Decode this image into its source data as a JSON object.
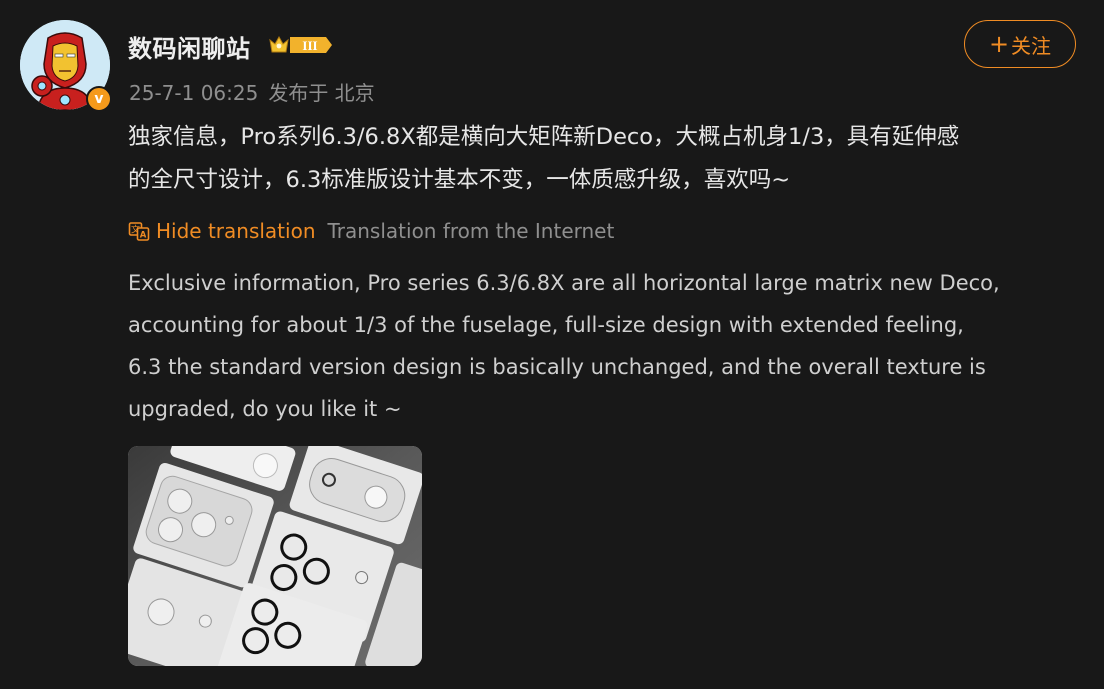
{
  "author": {
    "name": "数码闲聊站",
    "level_badge": "III",
    "verified_mark": "v",
    "avatar_icon": "iron-man-avatar"
  },
  "meta": {
    "time": "25-7-1 06:25",
    "location": "发布于 北京"
  },
  "follow": {
    "plus": "+",
    "label": "关注"
  },
  "post": {
    "line1": "独家信息，Pro系列6.3/6.8X都是横向大矩阵新Deco，大概占机身1/3，具有延伸感",
    "line2": "的全尺寸设计，6.3标准版设计基本不变，一体质感升级，喜欢吗~"
  },
  "translation": {
    "hide_label": "Hide translation",
    "source": "Translation from the Internet",
    "lines": [
      "Exclusive information, Pro series 6.3/6.8X are all horizontal large matrix new Deco,",
      "accounting for about 1/3 of the fuselage, full-size design with extended feeling,",
      "6.3 the standard version design is basically unchanged, and the overall texture is",
      "upgraded, do you like it ~"
    ]
  },
  "colors": {
    "background": "#181818",
    "accent": "#f08c24",
    "muted": "#8f8f8f"
  }
}
